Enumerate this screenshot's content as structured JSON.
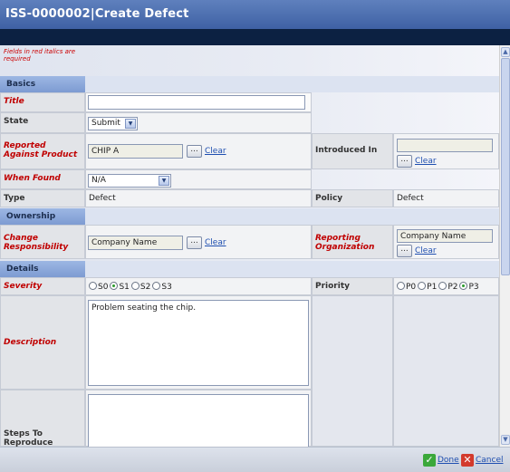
{
  "window": {
    "title": "ISS-0000002|Create Defect"
  },
  "required_note": "Fields in red italics are required",
  "sections": {
    "basics": "Basics",
    "ownership": "Ownership",
    "details": "Details"
  },
  "fields": {
    "title": {
      "label": "Title",
      "value": ""
    },
    "state": {
      "label": "State",
      "value": "Submit"
    },
    "reported_against": {
      "label": "Reported Against Product",
      "value": "CHIP A",
      "clear": "Clear"
    },
    "introduced_in": {
      "label": "Introduced In",
      "value": "",
      "clear": "Clear"
    },
    "when_found": {
      "label": "When Found",
      "value": "N/A"
    },
    "type": {
      "label": "Type",
      "value": "Defect"
    },
    "policy": {
      "label": "Policy",
      "value": "Defect"
    },
    "change_responsibility": {
      "label": "Change Responsibility",
      "value": "Company Name",
      "clear": "Clear"
    },
    "reporting_org": {
      "label": "Reporting Organization",
      "value": "Company Name",
      "clear": "Clear"
    },
    "severity": {
      "label": "Severity",
      "options": [
        "S0",
        "S1",
        "S2",
        "S3"
      ],
      "selected": "S1"
    },
    "priority": {
      "label": "Priority",
      "options": [
        "P0",
        "P1",
        "P2",
        "P3"
      ],
      "selected": "P3"
    },
    "description": {
      "label": "Description",
      "value": "Problem seating the chip."
    },
    "steps": {
      "label": "Steps To Reproduce",
      "value": ""
    }
  },
  "buttons": {
    "dots": "...",
    "done": "Done",
    "cancel": "Cancel"
  },
  "colors": {
    "title_bar": "#4a6cb0",
    "required": "#c00000",
    "section": "#8aa7da",
    "link": "#1f4fb0",
    "done_icon": "#3aa83a",
    "cancel_icon": "#d33a2c"
  }
}
